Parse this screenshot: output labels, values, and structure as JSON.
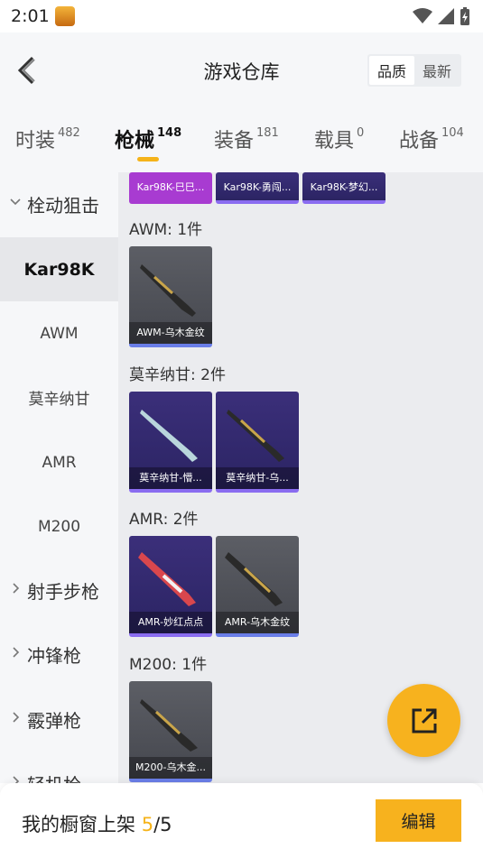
{
  "status": {
    "time": "2:01"
  },
  "header": {
    "title": "游戏仓库",
    "sort_options": [
      "品质",
      "最新"
    ],
    "sort_selected": "品质"
  },
  "tabs": [
    {
      "label": "时装",
      "count": "482"
    },
    {
      "label": "枪械",
      "count": "148"
    },
    {
      "label": "装备",
      "count": "181"
    },
    {
      "label": "载具",
      "count": "0"
    },
    {
      "label": "战备",
      "count": "104"
    }
  ],
  "active_tab": "枪械",
  "sidebar": {
    "items": [
      {
        "label": "栓动狙击",
        "type": "group",
        "expanded": true
      },
      {
        "label": "Kar98K",
        "type": "sub",
        "active": true
      },
      {
        "label": "AWM",
        "type": "sub"
      },
      {
        "label": "莫辛纳甘",
        "type": "sub"
      },
      {
        "label": "AMR",
        "type": "sub"
      },
      {
        "label": "M200",
        "type": "sub"
      },
      {
        "label": "射手步枪",
        "type": "group"
      },
      {
        "label": "冲锋枪",
        "type": "group"
      },
      {
        "label": "霰弹枪",
        "type": "group"
      },
      {
        "label": "轻机枪",
        "type": "group"
      }
    ]
  },
  "content": {
    "top_partial_cards": [
      "Kar98K-巳巳...",
      "Kar98K-勇闯...",
      "Kar98K-梦幻..."
    ],
    "sections": [
      {
        "title": "AWM: 1件",
        "items": [
          "AWM-乌木金纹"
        ]
      },
      {
        "title": "莫辛纳甘: 2件",
        "items": [
          "莫辛纳甘-懵...",
          "莫辛纳甘-乌..."
        ]
      },
      {
        "title": "AMR: 2件",
        "items": [
          "AMR-妙红点点",
          "AMR-乌木金纹"
        ]
      },
      {
        "title": "M200: 1件",
        "items": [
          "M200-乌木金..."
        ]
      }
    ]
  },
  "bottom": {
    "showcase_label": "我的橱窗上架",
    "showcase_current": "5",
    "showcase_total": "/5",
    "edit_label": "编辑"
  },
  "colors": {
    "accent": "#f7b21e",
    "card_purple": "#3b2f7a",
    "card_gray": "#55575e",
    "card_magenta": "#a83bd1"
  }
}
